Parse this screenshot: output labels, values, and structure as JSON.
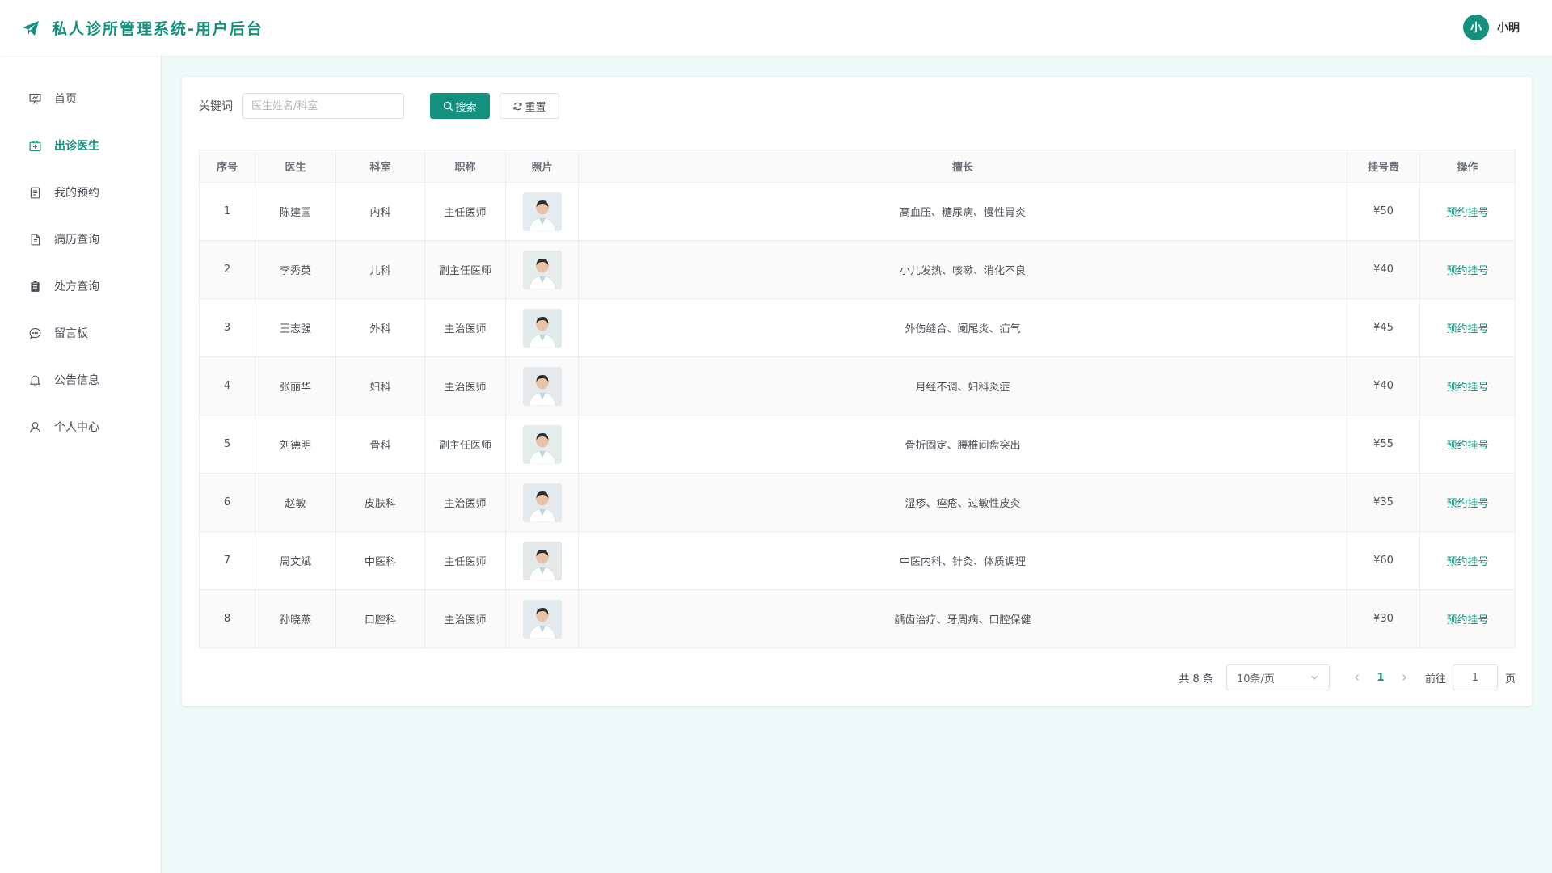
{
  "header": {
    "title": "私人诊所管理系统-用户后台",
    "logo_icon": "paper-plane-icon",
    "user_avatar": "小",
    "user_name": "小明"
  },
  "sidebar": {
    "items": [
      {
        "label": "首页",
        "icon": "presentation-icon",
        "active": false
      },
      {
        "label": "出诊医生",
        "icon": "first-aid-kit-icon",
        "active": true
      },
      {
        "label": "我的预约",
        "icon": "document-list-icon",
        "active": false
      },
      {
        "label": "病历查询",
        "icon": "document-icon",
        "active": false
      },
      {
        "label": "处方查询",
        "icon": "clipboard-icon",
        "active": false
      },
      {
        "label": "留言板",
        "icon": "chat-bubble-icon",
        "active": false
      },
      {
        "label": "公告信息",
        "icon": "bell-icon",
        "active": false
      },
      {
        "label": "个人中心",
        "icon": "user-icon",
        "active": false
      }
    ]
  },
  "search": {
    "label": "关键词",
    "placeholder": "医生姓名/科室",
    "value": "",
    "search_button": "搜索",
    "reset_button": "重置"
  },
  "table": {
    "columns": [
      "序号",
      "医生",
      "科室",
      "职称",
      "照片",
      "擅长",
      "挂号费",
      "操作"
    ],
    "rows": [
      {
        "no": "1",
        "name": "陈建国",
        "dept": "内科",
        "title": "主任医师",
        "specialty": "高血压、糖尿病、慢性胃炎",
        "fee": "¥50",
        "action": "预约挂号"
      },
      {
        "no": "2",
        "name": "李秀英",
        "dept": "儿科",
        "title": "副主任医师",
        "specialty": "小儿发热、咳嗽、消化不良",
        "fee": "¥40",
        "action": "预约挂号"
      },
      {
        "no": "3",
        "name": "王志强",
        "dept": "外科",
        "title": "主治医师",
        "specialty": "外伤缝合、阑尾炎、疝气",
        "fee": "¥45",
        "action": "预约挂号"
      },
      {
        "no": "4",
        "name": "张丽华",
        "dept": "妇科",
        "title": "主治医师",
        "specialty": "月经不调、妇科炎症",
        "fee": "¥40",
        "action": "预约挂号"
      },
      {
        "no": "5",
        "name": "刘德明",
        "dept": "骨科",
        "title": "副主任医师",
        "specialty": "骨折固定、腰椎间盘突出",
        "fee": "¥55",
        "action": "预约挂号"
      },
      {
        "no": "6",
        "name": "赵敏",
        "dept": "皮肤科",
        "title": "主治医师",
        "specialty": "湿疹、痤疮、过敏性皮炎",
        "fee": "¥35",
        "action": "预约挂号"
      },
      {
        "no": "7",
        "name": "周文斌",
        "dept": "中医科",
        "title": "主任医师",
        "specialty": "中医内科、针灸、体质调理",
        "fee": "¥60",
        "action": "预约挂号"
      },
      {
        "no": "8",
        "name": "孙晓燕",
        "dept": "口腔科",
        "title": "主治医师",
        "specialty": "龋齿治疗、牙周病、口腔保健",
        "fee": "¥30",
        "action": "预约挂号"
      }
    ]
  },
  "pagination": {
    "total": "共 8 条",
    "page_size": "10条/页",
    "current_page": "1",
    "goto_label": "前往",
    "goto_value": "1",
    "page_suffix": "页"
  },
  "colors": {
    "accent": "#14907f",
    "background": "#f0faf8"
  }
}
